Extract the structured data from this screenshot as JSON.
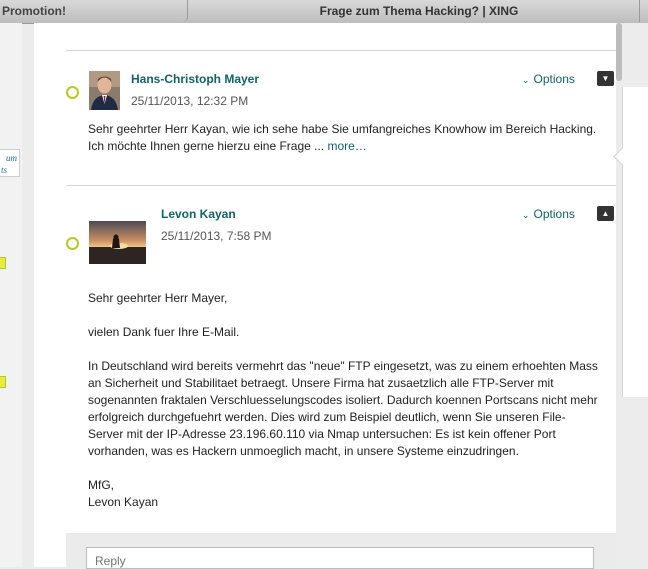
{
  "tabs": {
    "left": "Promotion!",
    "right": "Frage zum Thema Hacking? | XING"
  },
  "sidebar": {
    "tab_text_1": "um",
    "tab_text_2": "ts"
  },
  "posts": [
    {
      "author": "Hans-Christoph Mayer",
      "date": "25/11/2013, 12:32 PM",
      "options_label": "Options",
      "text_line1": "Sehr geehrter Herr Kayan, wie ich sehe habe Sie umfangreiches Knowhow im Bereich Hacking.",
      "text_line2": "Ich möchte Ihnen gerne hierzu eine Frage ...",
      "more_label": "more…",
      "avatar_icon": "person-photo"
    },
    {
      "author": "Levon Kayan",
      "date": "25/11/2013, 7:58 PM",
      "options_label": "Options",
      "greeting": "Sehr geehrter Herr Mayer,",
      "thanks": "vielen Dank fuer Ihre E-Mail.",
      "body_lines": [
        "In Deutschland wird bereits vermehrt das \"neue\" FTP eingesetzt, was zu einem erhoehten Mass",
        "an Sicherheit und Stabilitaet betraegt. Unsere Firma hat zusaetzlich alle FTP-Server mit",
        "sogenannten fraktalen Verschluesselungscodes isoliert. Dadurch koennen Portscans nicht mehr",
        "erfolgreich durchgefuehrt werden. Dies wird zum Beispiel deutlich, wenn Sie unseren File-",
        "Server mit der IP-Adresse 23.196.60.110 via Nmap untersuchen: Es ist kein offener Port",
        "vorhanden, was es Hackern unmoeglich macht, in unsere Systeme einzudringen."
      ],
      "closing": "MfG,",
      "signature": "Levon Kayan",
      "avatar_icon": "sunset-photo"
    }
  ],
  "reply": {
    "placeholder": "Reply"
  },
  "colors": {
    "accent": "#106366",
    "dot": "#b6cc1c"
  }
}
